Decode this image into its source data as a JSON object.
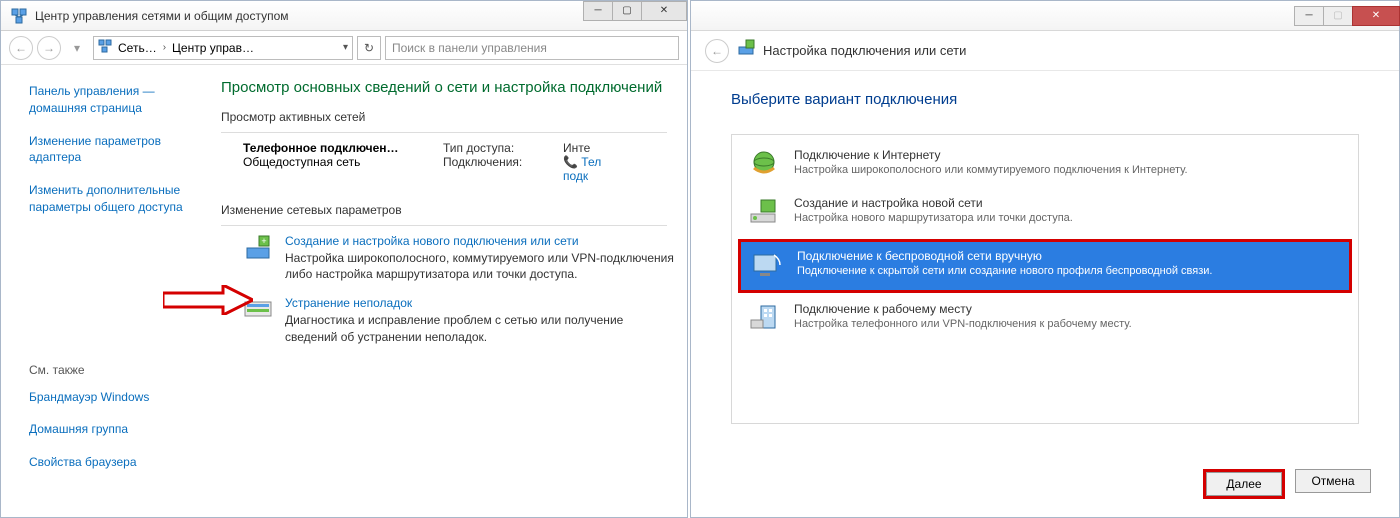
{
  "left": {
    "title": "Центр управления сетями и общим доступом",
    "address_part1": "Сеть…",
    "address_part2": "Центр управ…",
    "search_placeholder": "Поиск в панели управления",
    "side": {
      "home": "Панель управления — домашняя страница",
      "adapter": "Изменение параметров адаптера",
      "sharing": "Изменить дополнительные параметры общего доступа",
      "seealso_head": "См. также",
      "firewall": "Брандмауэр Windows",
      "homegroup": "Домашняя группа",
      "browser": "Свойства браузера"
    },
    "main": {
      "heading1": "Просмотр основных сведений о сети и настройка подключений",
      "sec_active": "Просмотр активных сетей",
      "conn_name": "Телефонное подключен…",
      "conn_type": "Общедоступная сеть",
      "lbl_access": "Тип доступа:",
      "val_access": "Инте",
      "lbl_conn": "Подключения:",
      "val_conn": "Тел",
      "val_conn2": "подк",
      "sec_change": "Изменение сетевых параметров",
      "task1_title": "Создание и настройка нового подключения или сети",
      "task1_desc": "Настройка широкополосного, коммутируемого или VPN-подключения либо настройка маршрутизатора или точки доступа.",
      "task2_title": "Устранение неполадок",
      "task2_desc": "Диагностика и исправление проблем с сетью или получение сведений об устранении неполадок."
    }
  },
  "right": {
    "wiz_title": "Настройка подключения или сети",
    "heading": "Выберите вариант подключения",
    "opt1_title": "Подключение к Интернету",
    "opt1_desc": "Настройка широкополосного или коммутируемого подключения к Интернету.",
    "opt2_title": "Создание и настройка новой сети",
    "opt2_desc": "Настройка нового маршрутизатора или точки доступа.",
    "opt3_title": "Подключение к беспроводной сети вручную",
    "opt3_desc": "Подключение к скрытой сети или создание нового профиля беспроводной связи.",
    "opt4_title": "Подключение к рабочему месту",
    "opt4_desc": "Настройка телефонного или VPN-подключения к рабочему месту.",
    "btn_next": "Далее",
    "btn_cancel": "Отмена"
  }
}
